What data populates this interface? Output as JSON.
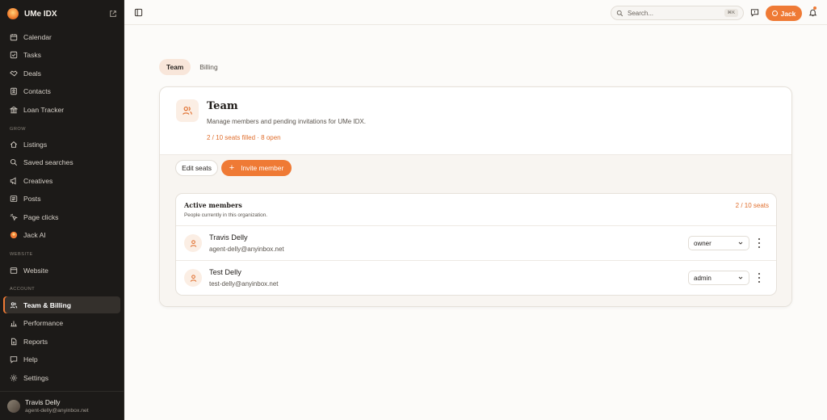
{
  "brand": {
    "name": "UMe IDX"
  },
  "sidebar": {
    "items_top": [
      {
        "label": "Calendar",
        "icon": "calendar-icon"
      },
      {
        "label": "Tasks",
        "icon": "checkbox-icon"
      },
      {
        "label": "Deals",
        "icon": "handshake-icon"
      },
      {
        "label": "Contacts",
        "icon": "contact-card-icon"
      },
      {
        "label": "Loan Tracker",
        "icon": "bank-icon"
      }
    ],
    "grow_label": "GROW",
    "items_grow": [
      {
        "label": "Listings",
        "icon": "home-icon"
      },
      {
        "label": "Saved searches",
        "icon": "search-icon"
      },
      {
        "label": "Creatives",
        "icon": "megaphone-icon"
      },
      {
        "label": "Posts",
        "icon": "newspaper-icon"
      },
      {
        "label": "Page clicks",
        "icon": "cursor-click-icon"
      },
      {
        "label": "Jack AI",
        "icon": "jack-ai-icon"
      }
    ],
    "website_label": "WEBSITE",
    "items_website": [
      {
        "label": "Website",
        "icon": "browser-icon"
      }
    ],
    "account_label": "ACCOUNT",
    "items_account": [
      {
        "label": "Team & Billing",
        "icon": "users-icon",
        "active": true
      },
      {
        "label": "Performance",
        "icon": "bar-chart-icon"
      },
      {
        "label": "Reports",
        "icon": "document-icon"
      },
      {
        "label": "Help",
        "icon": "chat-help-icon"
      },
      {
        "label": "Settings",
        "icon": "gear-icon"
      }
    ],
    "user": {
      "name": "Travis Delly",
      "email": "agent-delly@anyinbox.net"
    }
  },
  "topbar": {
    "search_placeholder": "Search...",
    "search_shortcut": "⌘K",
    "jack_label": "Jack"
  },
  "tabs": [
    {
      "label": "Team",
      "active": true
    },
    {
      "label": "Billing",
      "active": false
    }
  ],
  "team": {
    "title": "Team",
    "description": "Manage members and pending invitations for UMe IDX.",
    "seats_summary": "2 / 10 seats filled · 8 open",
    "edit_seats_label": "Edit seats",
    "invite_label": "Invite member"
  },
  "members": {
    "title": "Active members",
    "subtitle": "People currently in this organization.",
    "count": "2 / 10 seats",
    "rows": [
      {
        "name": "Travis Delly",
        "email": "agent-delly@anyinbox.net",
        "role": "owner"
      },
      {
        "name": "Test Delly",
        "email": "test-delly@anyinbox.net",
        "role": "admin"
      }
    ]
  },
  "colors": {
    "accent": "#ef7a35",
    "sidebar_bg": "#1c1a18",
    "main_bg": "#fcfbf9"
  }
}
